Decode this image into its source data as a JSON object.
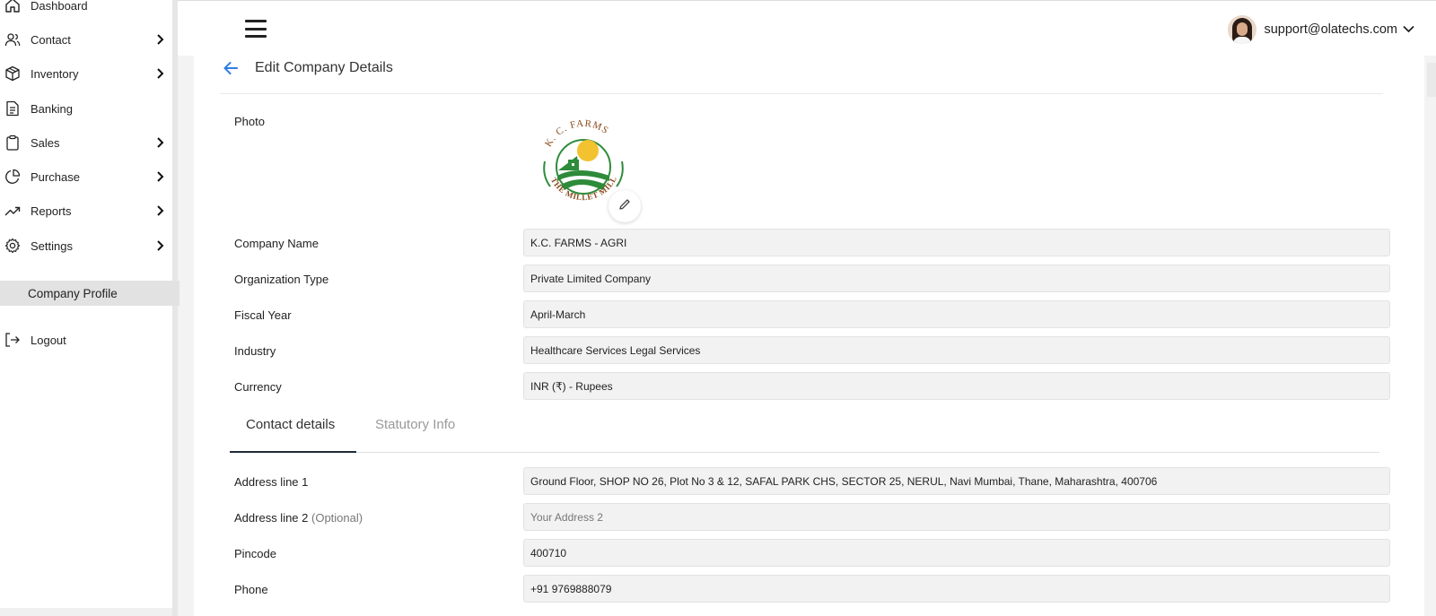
{
  "sidebar": {
    "items": [
      {
        "label": "Dashboard",
        "icon": "home-icon"
      },
      {
        "label": "Contact",
        "icon": "users-icon"
      },
      {
        "label": "Inventory",
        "icon": "box-icon"
      },
      {
        "label": "Banking",
        "icon": "document-icon"
      },
      {
        "label": "Sales",
        "icon": "clipboard-icon"
      },
      {
        "label": "Purchase",
        "icon": "pie-chart-icon"
      },
      {
        "label": "Reports",
        "icon": "trending-up-icon"
      },
      {
        "label": "Settings",
        "icon": "gear-icon"
      }
    ],
    "sub_item": "Company Profile",
    "logout": "Logout"
  },
  "header": {
    "user_email": "support@olatechs.com"
  },
  "page": {
    "title": "Edit Company Details"
  },
  "logo": {
    "top_text": "K. C. FARMS",
    "bottom_text": "THE MILLET MILL"
  },
  "form": {
    "photo_label": "Photo",
    "company_name": {
      "label": "Company Name",
      "value": "K.C. FARMS - AGRI"
    },
    "organization_type": {
      "label": "Organization Type",
      "value": "Private Limited Company"
    },
    "fiscal_year": {
      "label": "Fiscal Year",
      "value": "April-March"
    },
    "industry": {
      "label": "Industry",
      "value": "Healthcare Services Legal Services"
    },
    "currency": {
      "label": "Currency",
      "value": "INR (₹) - Rupees"
    }
  },
  "tabs": {
    "active": "Contact details",
    "inactive": "Statutory Info"
  },
  "contact": {
    "address1": {
      "label": "Address line 1",
      "value": "Ground Floor, SHOP NO 26, Plot No 3 & 12, SAFAL PARK CHS, SECTOR 25, NERUL, Navi Mumbai, Thane, Maharashtra, 400706"
    },
    "address2": {
      "label": "Address line 2",
      "optional": "(Optional)",
      "placeholder": "Your Address 2"
    },
    "pincode": {
      "label": "Pincode",
      "value": "400710"
    },
    "phone": {
      "label": "Phone",
      "value": "+91 9769888079"
    }
  },
  "colors": {
    "accent_blue": "#2f7de1",
    "tab_underline": "#1f2b3a",
    "logo_green": "#2e8b3a",
    "logo_brown": "#8a4a1c",
    "logo_yellow": "#f2c230"
  }
}
